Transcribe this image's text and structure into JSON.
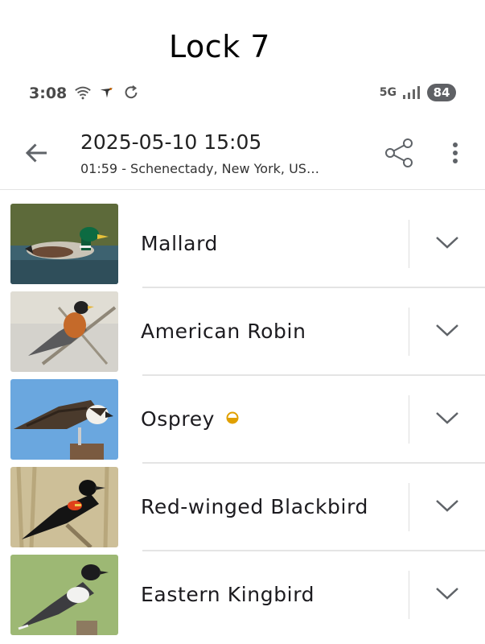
{
  "caption": "Lock 7",
  "status_bar": {
    "time": "3:08",
    "network": "5G",
    "battery": "84"
  },
  "app_bar": {
    "title": "2025-05-10 15:05",
    "subtitle": "01:59 - Schenectady, New York, US…"
  },
  "species": [
    {
      "name": "Mallard",
      "has_badge": false
    },
    {
      "name": "American Robin",
      "has_badge": false
    },
    {
      "name": "Osprey",
      "has_badge": true
    },
    {
      "name": "Red-winged Blackbird",
      "has_badge": false
    },
    {
      "name": "Eastern Kingbird",
      "has_badge": false
    }
  ],
  "colors": {
    "badge": "#e0a000",
    "divider": "#e4e4e4",
    "icon": "#5f6368"
  }
}
